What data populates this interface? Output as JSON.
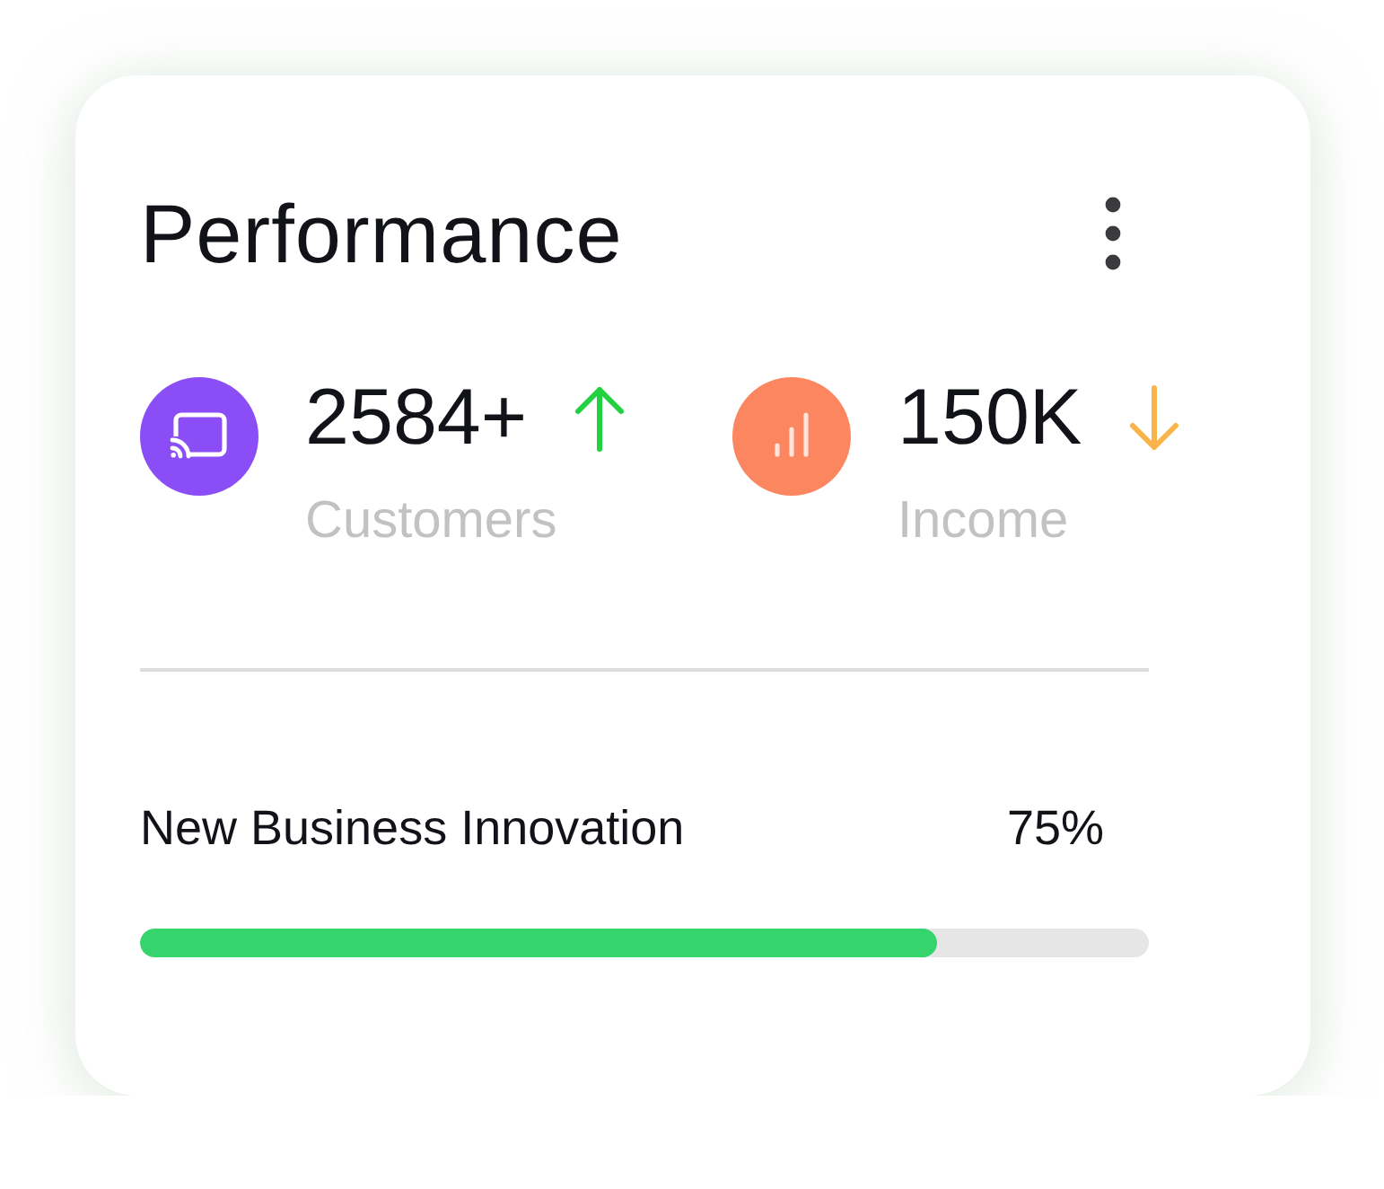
{
  "card": {
    "title": "Performance"
  },
  "stats": [
    {
      "value": "2584+",
      "label": "Customers",
      "rising": true,
      "color": "#8a4df6"
    },
    {
      "value": "150K",
      "label": "Income",
      "rising": false,
      "color": "#fb8660"
    }
  ],
  "progress": {
    "label": "New Business Innovation",
    "value": "75%",
    "level": 0.79
  }
}
